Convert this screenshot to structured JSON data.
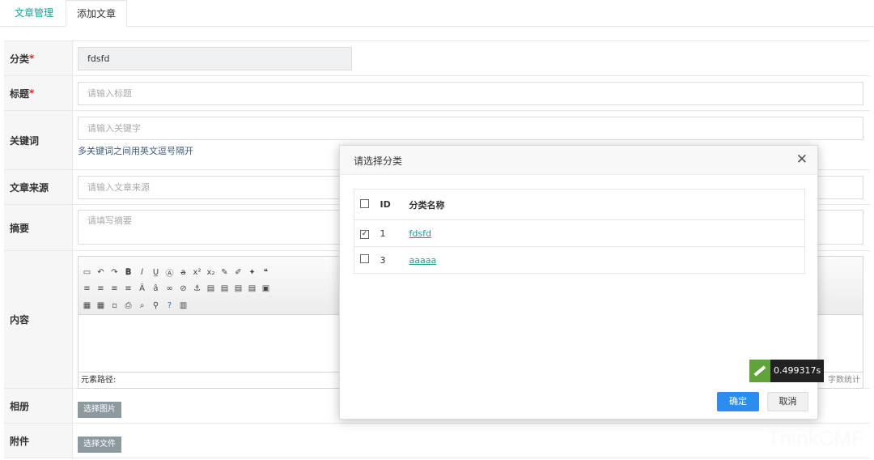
{
  "tabs": [
    {
      "label": "文章管理"
    },
    {
      "label": "添加文章"
    }
  ],
  "form": {
    "category": {
      "label": "分类",
      "required_mark": "*",
      "value": "fdsfd"
    },
    "title": {
      "label": "标题",
      "required_mark": "*",
      "placeholder": "请输入标题"
    },
    "keywords": {
      "label": "关键词",
      "placeholder": "请输入关键字",
      "help": "多关键词之间用英文逗号隔开"
    },
    "source": {
      "label": "文章来源",
      "placeholder": "请输入文章来源"
    },
    "summary": {
      "label": "摘要",
      "placeholder": "请填写摘要"
    },
    "content": {
      "label": "内容",
      "status_path": "元素路径:",
      "word_count": "字数统计"
    },
    "album": {
      "label": "相册",
      "button": "选择图片"
    },
    "attachment": {
      "label": "附件",
      "button": "选择文件"
    }
  },
  "dialog": {
    "title": "请选择分类",
    "columns": {
      "id": "ID",
      "name": "分类名称"
    },
    "rows": [
      {
        "checked": true,
        "id": "1",
        "name": "fdsfd"
      },
      {
        "checked": false,
        "id": "3",
        "name": "aaaaa"
      }
    ],
    "ok": "确定",
    "cancel": "取消"
  },
  "timer": "0.499317s",
  "watermark": "ThinkCMF"
}
